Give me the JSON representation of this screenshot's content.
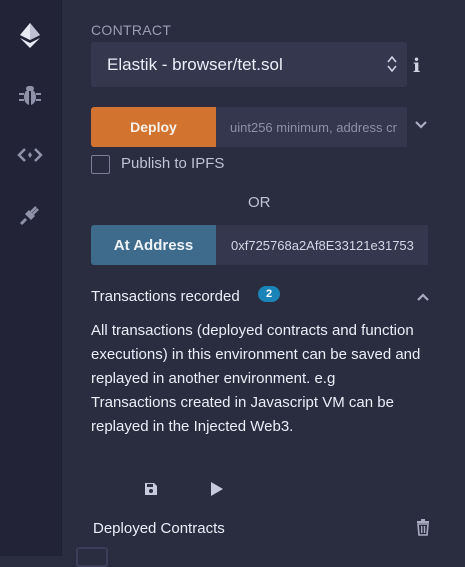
{
  "sidebar": {
    "items": [
      {
        "name": "deploy-run-plugin",
        "icon": "ethereum-deploy-icon"
      },
      {
        "name": "debugger-plugin",
        "icon": "bug-icon"
      },
      {
        "name": "file-explorer-plugin",
        "icon": "code-arrows-icon"
      },
      {
        "name": "plugin-manager",
        "icon": "plug-icon"
      }
    ]
  },
  "contract": {
    "label": "CONTRACT",
    "selected": "Elastik - browser/tet.sol"
  },
  "deploy": {
    "button_label": "Deploy",
    "params_placeholder": "uint256 minimum, address cr"
  },
  "publish": {
    "label": "Publish to IPFS"
  },
  "or_label": "OR",
  "at_address": {
    "button_label": "At Address",
    "value": "0xf725768a2Af8E33121e31753"
  },
  "transactions": {
    "title": "Transactions recorded",
    "count": "2",
    "description": "All transactions (deployed contracts and function executions) in this environment can be saved and replayed in another environment. e.g Transactions created in Javascript VM can be replayed in the Injected Web3."
  },
  "deployed": {
    "title": "Deployed Contracts"
  },
  "colors": {
    "deploy_accent": "#d2742f",
    "at_address_accent": "#3e6b8c",
    "badge": "#1a83b8"
  }
}
